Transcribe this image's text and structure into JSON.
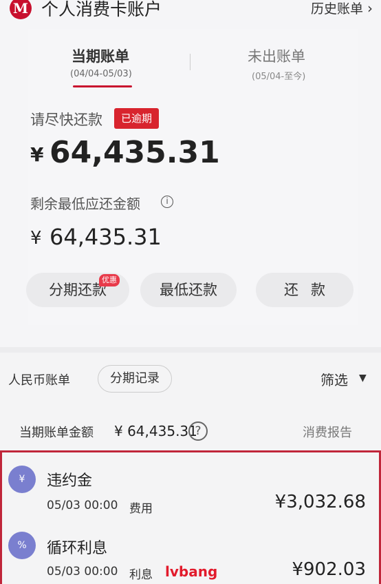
{
  "header": {
    "logo_char": "M",
    "title": "个人消费卡账户",
    "history": "历史账单",
    "chevron": "›"
  },
  "tabs": [
    {
      "label": "当期账单",
      "date": "(04/04-05/03)"
    },
    {
      "label": "未出账单",
      "date": "(05/04-至今)"
    }
  ],
  "summary": {
    "repay_label": "请尽快还款",
    "overdue_badge": "已逾期",
    "currency": "¥",
    "amount": "64,435.31",
    "min_label": "剩余最低应还金额",
    "info_glyph": "i",
    "min_amount": "64,435.31"
  },
  "actions": {
    "installment": "分期还款",
    "promo_badge": "优惠",
    "min_repay": "最低还款",
    "repay": "还款"
  },
  "toolbar": {
    "rmb": "人民币账单",
    "installment_record": "分期记录",
    "filter": "筛选",
    "filter_arrow": "▼"
  },
  "bill": {
    "label": "当期账单金额",
    "amount": "¥ 64,435.31",
    "help_glyph": "?",
    "report": "消费报告"
  },
  "transactions": [
    {
      "icon": "¥",
      "title": "违约金",
      "date": "05/03 00:00",
      "category": "费用",
      "amount": "¥3,032.68"
    },
    {
      "icon": "%",
      "title": "循环利息",
      "date": "05/03 00:00",
      "category": "利息",
      "amount": "¥902.03"
    }
  ],
  "watermark": "lvbang"
}
